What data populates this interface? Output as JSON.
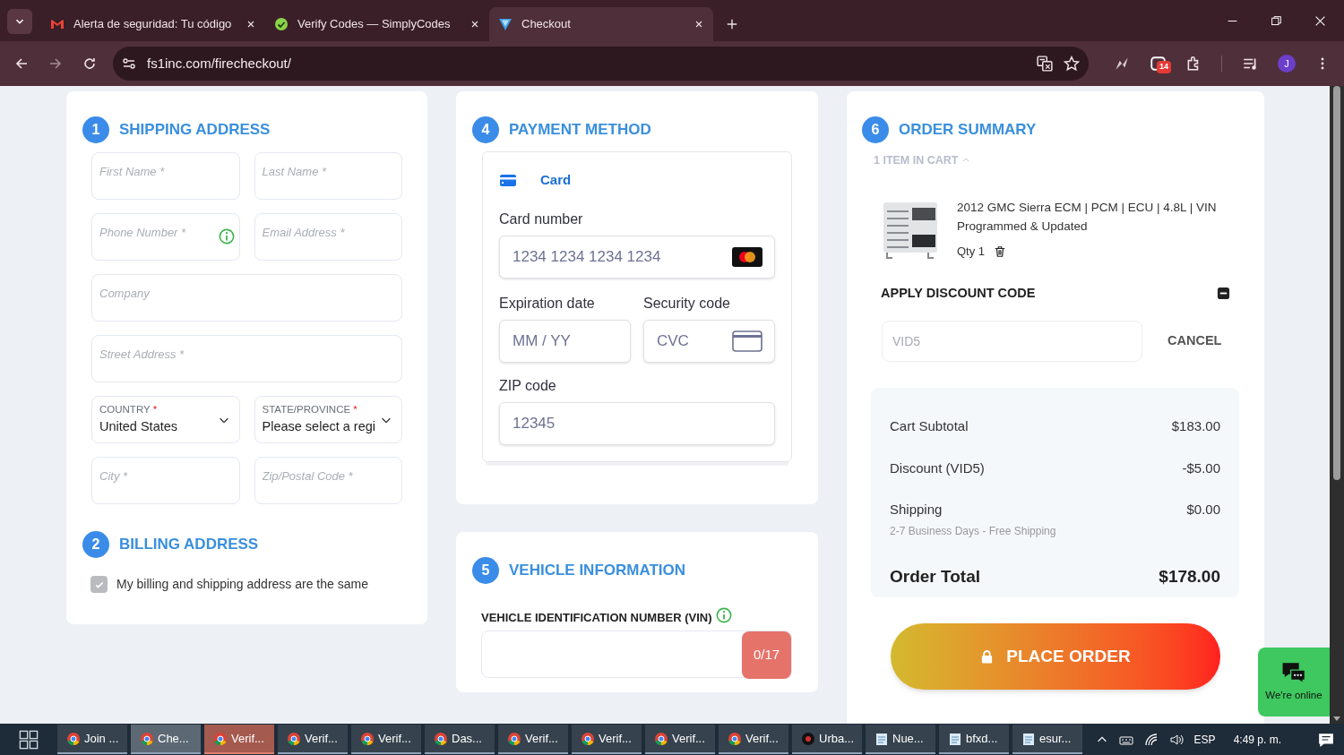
{
  "browser": {
    "tabs": [
      {
        "kind": "mail",
        "title": "Alerta de seguridad: Tu código",
        "selected": false
      },
      {
        "kind": "check",
        "title": "Verify Codes — SimplyCodes",
        "selected": false
      },
      {
        "kind": "logo",
        "title": "Checkout",
        "selected": true
      }
    ],
    "url": "fs1inc.com/firecheckout/",
    "extension_badge": "14",
    "avatar": "J"
  },
  "shipping": {
    "step": "1",
    "title": "SHIPPING ADDRESS",
    "fields": [
      {
        "kind": "text",
        "placeholder": "First Name *",
        "info": false
      },
      {
        "kind": "text",
        "placeholder": "Last Name *",
        "info": false
      },
      {
        "kind": "text",
        "placeholder": "Phone Number *",
        "info": true
      },
      {
        "kind": "text",
        "placeholder": "Email Address *",
        "info": false
      },
      {
        "kind": "wide",
        "placeholder": "Company",
        "info": false
      },
      {
        "kind": "wide",
        "placeholder": "Street Address *",
        "info": false
      },
      {
        "kind": "select",
        "label": "COUNTRY",
        "required_mark": "*",
        "value": "United States"
      },
      {
        "kind": "select",
        "label": "STATE/PROVINCE",
        "required_mark": "*",
        "value": "Please select a regi"
      },
      {
        "kind": "text",
        "placeholder": "City *",
        "info": false
      },
      {
        "kind": "text",
        "placeholder": "Zip/Postal Code *",
        "info": false
      }
    ]
  },
  "billing": {
    "step": "2",
    "title": "BILLING ADDRESS",
    "same_address": {
      "label": "My billing and shipping address are the same",
      "checked": true
    }
  },
  "payment": {
    "step": "4",
    "title": "PAYMENT METHOD",
    "method": "Card",
    "card_number": {
      "label": "Card number",
      "placeholder": "1234 1234 1234 1234"
    },
    "expiry": {
      "label": "Expiration date",
      "placeholder": "MM / YY"
    },
    "security": {
      "label": "Security code",
      "placeholder": "CVC"
    },
    "zip": {
      "label": "ZIP code",
      "placeholder": "12345"
    }
  },
  "vehicle": {
    "step": "5",
    "title": "VEHICLE INFORMATION",
    "vin_label": "VEHICLE IDENTIFICATION NUMBER (VIN)",
    "counter": "0/17"
  },
  "summary": {
    "step": "6",
    "title": "ORDER SUMMARY",
    "cart_count": "1 ITEM IN CART",
    "expanded": true,
    "item": {
      "name": "2012 GMC Sierra ECM | PCM | ECU | 4.8L | VIN Programmed & Updated",
      "qty": "Qty 1"
    },
    "discount": {
      "title": "APPLY DISCOUNT CODE",
      "value": "VID5",
      "disabled": true,
      "cancel": "CANCEL"
    },
    "lines": [
      {
        "label": "Cart Subtotal",
        "amount": "$183.00"
      },
      {
        "label": "Discount (VID5)",
        "amount": "-$5.00"
      },
      {
        "label": "Shipping",
        "amount": "$0.00",
        "note": "2-7 Business Days - Free Shipping"
      }
    ],
    "total": {
      "label": "Order Total",
      "amount": "$178.00"
    },
    "place_order": "PLACE ORDER"
  },
  "chat": {
    "label": "We're online"
  },
  "taskbar": {
    "items": [
      {
        "kind": "chrome",
        "label": "Join ...",
        "selected": false,
        "attention": false
      },
      {
        "kind": "chrome",
        "label": "Che...",
        "selected": true,
        "attention": false
      },
      {
        "kind": "chrome",
        "label": "Verif...",
        "selected": false,
        "attention": true
      },
      {
        "kind": "chrome",
        "label": "Verif...",
        "selected": false,
        "attention": false
      },
      {
        "kind": "chrome",
        "label": "Verif...",
        "selected": false,
        "attention": false
      },
      {
        "kind": "chrome",
        "label": "Das...",
        "selected": false,
        "attention": false
      },
      {
        "kind": "chrome",
        "label": "Verif...",
        "selected": false,
        "attention": false
      },
      {
        "kind": "chrome",
        "label": "Verif...",
        "selected": false,
        "attention": false
      },
      {
        "kind": "chrome",
        "label": "Verif...",
        "selected": false,
        "attention": false
      },
      {
        "kind": "chrome",
        "label": "Verif...",
        "selected": false,
        "attention": false
      },
      {
        "kind": "media",
        "label": "Urba...",
        "selected": false,
        "attention": false
      },
      {
        "kind": "notepad",
        "label": "Nue...",
        "selected": false,
        "attention": false
      },
      {
        "kind": "notepad",
        "label": "bfxd...",
        "selected": false,
        "attention": false
      },
      {
        "kind": "notepad",
        "label": "esur...",
        "selected": false,
        "attention": false
      }
    ],
    "language": "ESP",
    "time": "4:49 p. m."
  }
}
